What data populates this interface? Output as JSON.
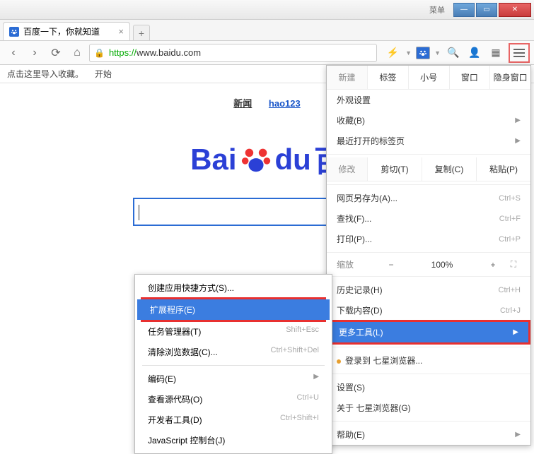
{
  "titlebar": {
    "menu": "菜单"
  },
  "tab": {
    "title": "百度一下，你就知道"
  },
  "url": {
    "protocol": "https://",
    "host": "www.baidu.com"
  },
  "bookmarkbar": {
    "hint": "点击这里导入收藏。",
    "start": "开始"
  },
  "pagenav": {
    "news": "新闻",
    "hao123": "hao123"
  },
  "logo": {
    "text1": "Bai",
    "text2": "du",
    "text3": "百"
  },
  "mainmenu": {
    "new_label": "新建",
    "tab": "标签",
    "small": "小号",
    "window": "窗口",
    "incognito": "隐身窗口",
    "appearance": "外观设置",
    "favorites": "收藏(B)",
    "recent": "最近打开的标签页",
    "edit_label": "修改",
    "cut": "剪切(T)",
    "copy": "复制(C)",
    "paste": "粘贴(P)",
    "saveas": "网页另存为(A)...",
    "saveas_sc": "Ctrl+S",
    "find": "查找(F)...",
    "find_sc": "Ctrl+F",
    "print": "打印(P)...",
    "print_sc": "Ctrl+P",
    "zoom_label": "缩放",
    "zoom_val": "100%",
    "history": "历史记录(H)",
    "history_sc": "Ctrl+H",
    "downloads": "下载内容(D)",
    "downloads_sc": "Ctrl+J",
    "moretools": "更多工具(L)",
    "login": "登录到 七星浏览器...",
    "settings": "设置(S)",
    "about": "关于 七星浏览器(G)",
    "help": "帮助(E)"
  },
  "contextmenu": {
    "create_shortcut": "创建应用快捷方式(S)...",
    "extensions": "扩展程序(E)",
    "taskmgr": "任务管理器(T)",
    "taskmgr_sc": "Shift+Esc",
    "clear": "清除浏览数据(C)...",
    "clear_sc": "Ctrl+Shift+Del",
    "encoding": "编码(E)",
    "viewsource": "查看源代码(O)",
    "viewsource_sc": "Ctrl+U",
    "devtools": "开发者工具(D)",
    "devtools_sc": "Ctrl+Shift+I",
    "jsconsole": "JavaScript 控制台(J)"
  }
}
